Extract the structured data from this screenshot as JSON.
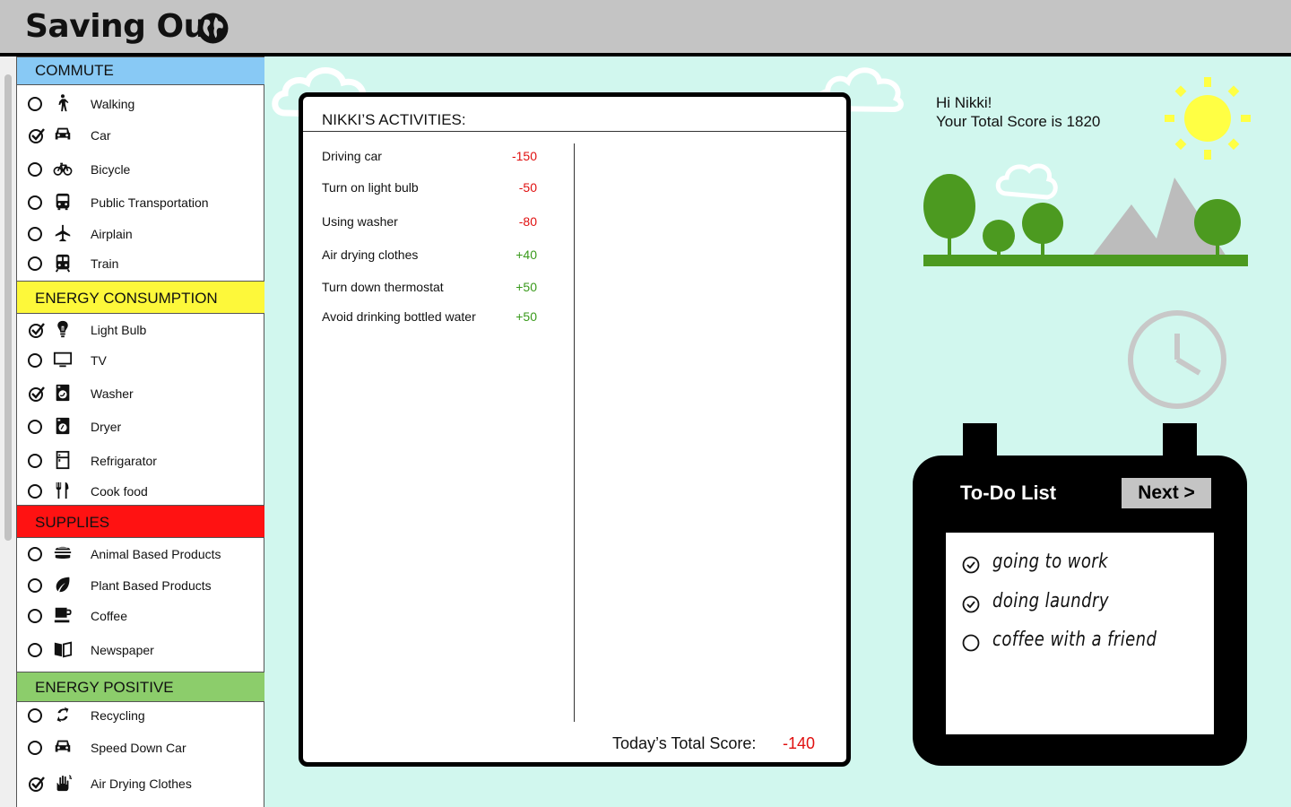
{
  "header": {
    "title": "Saving Our",
    "globe_icon": "globe-icon"
  },
  "sidebar": {
    "sections": [
      {
        "label": "COMMUTE",
        "color": "#88c9f5"
      },
      {
        "label": "ENERGY CONSUMPTION",
        "color": "#fdf83a"
      },
      {
        "label": "SUPPLIES",
        "color": "#ff1212"
      },
      {
        "label": "ENERGY POSITIVE",
        "color": "#8ccd6b"
      }
    ],
    "commute": [
      {
        "label": "Walking",
        "checked": false,
        "icon": "walking-icon"
      },
      {
        "label": "Car",
        "checked": true,
        "icon": "car-icon"
      },
      {
        "label": "Bicycle",
        "checked": false,
        "icon": "bicycle-icon"
      },
      {
        "label": "Public Transportation",
        "checked": false,
        "icon": "bus-icon"
      },
      {
        "label": "Airplain",
        "checked": false,
        "icon": "airplane-icon"
      },
      {
        "label": "Train",
        "checked": false,
        "icon": "train-icon"
      }
    ],
    "energy": [
      {
        "label": "Light Bulb",
        "checked": true,
        "icon": "lightbulb-icon"
      },
      {
        "label": "TV",
        "checked": false,
        "icon": "tv-icon"
      },
      {
        "label": "Washer",
        "checked": true,
        "icon": "washer-icon"
      },
      {
        "label": "Dryer",
        "checked": false,
        "icon": "dryer-icon"
      },
      {
        "label": "Refrigarator",
        "checked": false,
        "icon": "refrigerator-icon"
      },
      {
        "label": "Cook food",
        "checked": false,
        "icon": "utensils-icon"
      }
    ],
    "supplies": [
      {
        "label": "Animal Based Products",
        "checked": false,
        "icon": "burger-icon"
      },
      {
        "label": "Plant Based Products",
        "checked": false,
        "icon": "leaf-icon"
      },
      {
        "label": "Coffee",
        "checked": false,
        "icon": "coffee-icon"
      },
      {
        "label": "Newspaper",
        "checked": false,
        "icon": "book-icon"
      }
    ],
    "positive": [
      {
        "label": "Recycling",
        "checked": false,
        "icon": "recycle-icon"
      },
      {
        "label": "Speed Down Car",
        "checked": false,
        "icon": "car-icon"
      },
      {
        "label": "Air Drying Clothes",
        "checked": true,
        "icon": "hand-icon"
      }
    ]
  },
  "activities": {
    "title": "NIKKI’S ACTIVITIES:",
    "rows": [
      {
        "label": "Driving car",
        "points": "-150",
        "kind": "neg"
      },
      {
        "label": "Turn on light bulb",
        "points": "-50",
        "kind": "neg"
      },
      {
        "label": "Using washer",
        "points": "-80",
        "kind": "neg"
      },
      {
        "label": "Air drying clothes",
        "points": "+40",
        "kind": "pos"
      },
      {
        "label": "Turn down thermostat",
        "points": "+50",
        "kind": "pos"
      },
      {
        "label": "Avoid drinking bottled water",
        "points": "+50",
        "kind": "pos"
      }
    ],
    "total_label": "Today’s Total Score:",
    "total_value": "-140"
  },
  "greeting": {
    "hello": "Hi Nikki!",
    "score_text": "Your Total Score is  1820"
  },
  "todo": {
    "title": "To-Do List",
    "next_label": "Next >",
    "items": [
      {
        "text": "going to work",
        "done": true
      },
      {
        "text": "doing laundry",
        "done": true
      },
      {
        "text": "coffee with a friend",
        "done": false
      }
    ]
  },
  "colors": {
    "background": "#d1f7ee",
    "tree": "#4c9a20",
    "mountain": "#bcbcbc",
    "sun": "#ffff44",
    "clock": "#c8c8c8"
  }
}
